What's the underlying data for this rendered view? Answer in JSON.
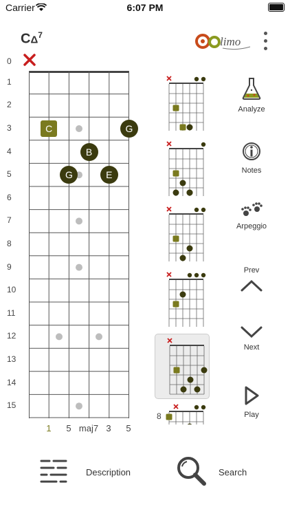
{
  "status": {
    "carrier": "Carrier",
    "time": "6:07 PM"
  },
  "chord": {
    "name": "C",
    "symbol": "Δ",
    "extension": "7"
  },
  "fret_numbers": [
    "0",
    "1",
    "2",
    "3",
    "4",
    "5",
    "6",
    "7",
    "8",
    "9",
    "10",
    "11",
    "12",
    "13",
    "14",
    "15"
  ],
  "fretboard_notes": [
    {
      "label": "C",
      "string": 2,
      "fret": 3,
      "role": "root"
    },
    {
      "label": "G",
      "string": 6,
      "fret": 3,
      "role": "tone"
    },
    {
      "label": "B",
      "string": 4,
      "fret": 4,
      "role": "tone"
    },
    {
      "label": "G",
      "string": 3,
      "fret": 5,
      "role": "tone"
    },
    {
      "label": "E",
      "string": 5,
      "fret": 5,
      "role": "tone"
    }
  ],
  "intervals": [
    {
      "label": "1",
      "role": "root"
    },
    {
      "label": "5",
      "role": "tone"
    },
    {
      "label": "maj7",
      "role": "tone"
    },
    {
      "label": "3",
      "role": "tone"
    },
    {
      "label": "5",
      "role": "tone"
    }
  ],
  "side_buttons": {
    "analyze": "Analyze",
    "notes": "Notes",
    "arpeggio": "Arpeggio",
    "prev": "Prev",
    "next": "Next",
    "play": "Play"
  },
  "mini_chart_fret_label": "8",
  "bottom_bar": {
    "description": "Description",
    "search": "Search"
  },
  "colors": {
    "root": "#7a7a1f",
    "tone": "#3b3b0f",
    "mute": "#c81e1e",
    "accent": "#555"
  }
}
